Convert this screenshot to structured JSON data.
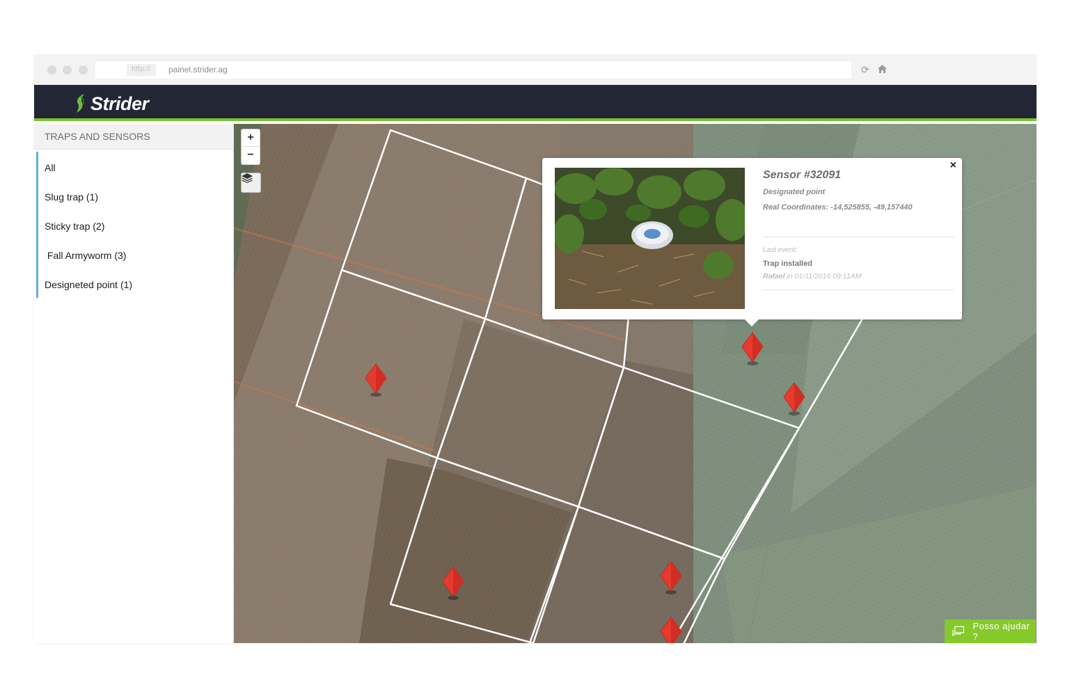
{
  "browser": {
    "protocol": "http://",
    "url": "painel.strider.ag"
  },
  "app": {
    "logo": "Strider",
    "accent": "#7cc234",
    "header_bg": "#232634"
  },
  "sidebar": {
    "title": "TRAPS AND SENSORS",
    "items": [
      {
        "label": "All"
      },
      {
        "label": "Slug trap (1)"
      },
      {
        "label": "Sticky trap (2)"
      },
      {
        "label": " Fall Armyworm (3)"
      },
      {
        "label": "Designeted point (1)"
      }
    ]
  },
  "map": {
    "zoom_in": "+",
    "zoom_out": "−",
    "marker_color": "#e63a2e",
    "marker_count": 7
  },
  "popup": {
    "close": "×",
    "title": "Sensor #32091",
    "subtitle": "Designated point",
    "coordinates": "Real Coordinates: -14,525855, -49,157440",
    "last_event_label": "Last event",
    "last_event_colon": ":",
    "event_name": "Trap installed",
    "event_user": "Rafael",
    "event_when": " in 01/11/2016 09:11AM"
  },
  "help": {
    "label": "Posso ajudar ?",
    "color": "#86c92b"
  }
}
